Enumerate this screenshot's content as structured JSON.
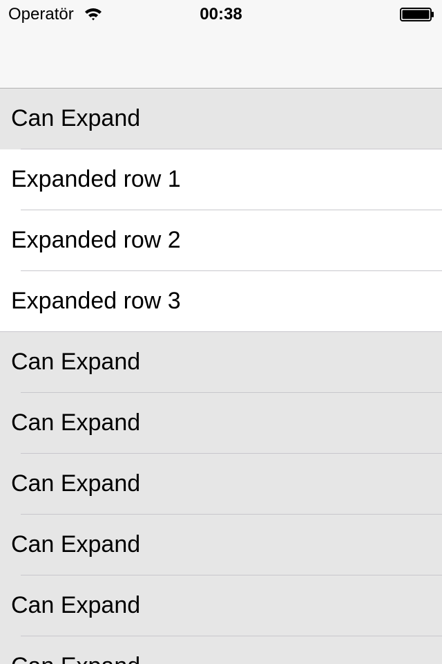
{
  "status_bar": {
    "carrier": "Operatör",
    "time": "00:38",
    "icons": [
      "wifi-icon",
      "battery-icon"
    ]
  },
  "nav_bar": {
    "title": ""
  },
  "table": {
    "rows": [
      {
        "label": "Can Expand",
        "kind": "collapsed"
      },
      {
        "label": "Expanded row 1",
        "kind": "expanded"
      },
      {
        "label": "Expanded row 2",
        "kind": "expanded"
      },
      {
        "label": "Expanded row 3",
        "kind": "expanded"
      },
      {
        "label": "Can Expand",
        "kind": "collapsed"
      },
      {
        "label": "Can Expand",
        "kind": "collapsed"
      },
      {
        "label": "Can Expand",
        "kind": "collapsed"
      },
      {
        "label": "Can Expand",
        "kind": "collapsed"
      },
      {
        "label": "Can Expand",
        "kind": "collapsed"
      },
      {
        "label": "Can Expand",
        "kind": "collapsed"
      }
    ]
  },
  "colors": {
    "collapsed_bg": "#e6e6e6",
    "expanded_bg": "#ffffff",
    "separator": "#c8c7cc",
    "bar_bg": "#f7f7f7"
  }
}
